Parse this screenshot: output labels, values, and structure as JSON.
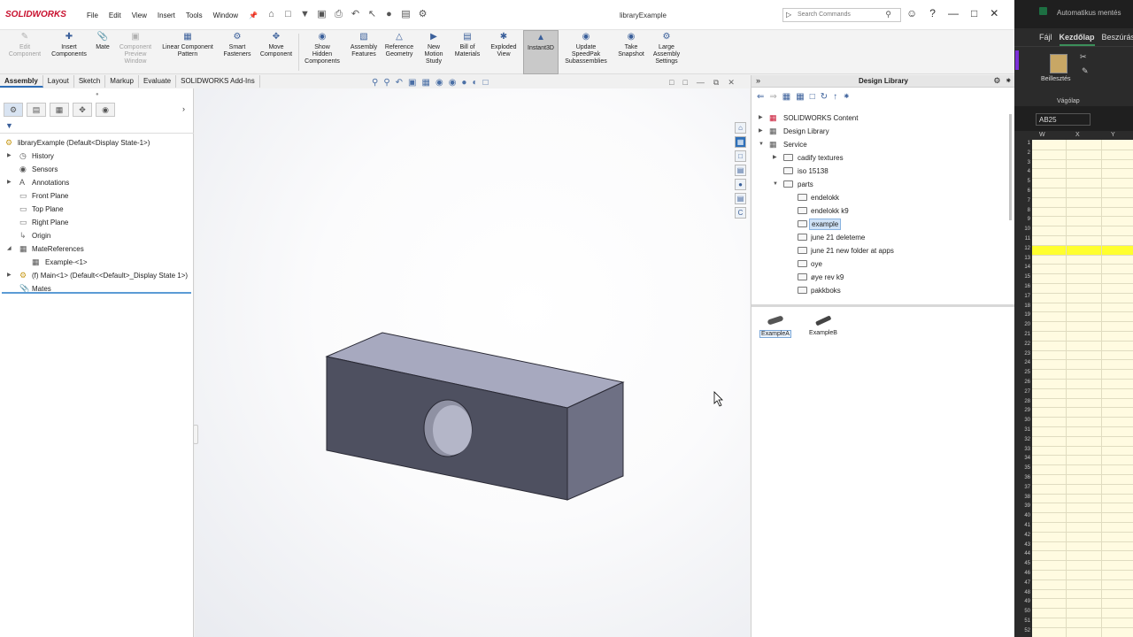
{
  "titlebar": {
    "app": "SOLIDWORKS",
    "doc_title": "libraryExample",
    "menu": [
      "File",
      "Edit",
      "View",
      "Insert",
      "Tools",
      "Window"
    ],
    "search_placeholder": "Search Commands"
  },
  "ribbon": {
    "edit_component": [
      "Edit",
      "Component"
    ],
    "insert_components": [
      "Insert",
      "Components"
    ],
    "mate": [
      "Mate"
    ],
    "component_preview": [
      "Component",
      "Preview",
      "Window"
    ],
    "linear_pattern": [
      "Linear Component",
      "Pattern"
    ],
    "smart_fasteners": [
      "Smart",
      "Fasteners"
    ],
    "move_component": [
      "Move",
      "Component"
    ],
    "show_hidden": [
      "Show",
      "Hidden",
      "Components"
    ],
    "assembly_features": [
      "Assembly",
      "Features"
    ],
    "reference_geometry": [
      "Reference",
      "Geometry"
    ],
    "new_motion_study": [
      "New",
      "Motion",
      "Study"
    ],
    "bill_of_materials": [
      "Bill of",
      "Materials"
    ],
    "exploded_view": [
      "Exploded",
      "View"
    ],
    "instant3d": [
      "Instant3D"
    ],
    "update_speedpak": [
      "Update",
      "SpeedPak",
      "Subassemblies"
    ],
    "take_snapshot": [
      "Take",
      "Snapshot"
    ],
    "large_assembly": [
      "Large",
      "Assembly",
      "Settings"
    ]
  },
  "tabs": [
    "Assembly",
    "Layout",
    "Sketch",
    "Markup",
    "Evaluate",
    "SOLIDWORKS Add-Ins"
  ],
  "feature_tree": {
    "root": "libraryExample  (Default<Display State-1>)",
    "items": [
      {
        "label": "History",
        "expandable": true,
        "indent": 1
      },
      {
        "label": "Sensors",
        "expandable": false,
        "indent": 1
      },
      {
        "label": "Annotations",
        "expandable": true,
        "indent": 1
      },
      {
        "label": "Front Plane",
        "expandable": false,
        "indent": 1
      },
      {
        "label": "Top Plane",
        "expandable": false,
        "indent": 1
      },
      {
        "label": "Right Plane",
        "expandable": false,
        "indent": 1
      },
      {
        "label": "Origin",
        "expandable": false,
        "indent": 1
      },
      {
        "label": "MateReferences",
        "expandable": true,
        "expanded": true,
        "indent": 1
      },
      {
        "label": "Example-<1>",
        "expandable": false,
        "indent": 2
      },
      {
        "label": "(f) Main<1> (Default<<Default>_Display State 1>)",
        "expandable": true,
        "indent": 1
      },
      {
        "label": "Mates",
        "expandable": false,
        "indent": 1
      }
    ]
  },
  "design_library": {
    "title": "Design Library",
    "tree": [
      {
        "label": "SOLIDWORKS Content",
        "indent": 0,
        "arrow": "collapsed"
      },
      {
        "label": "Design Library",
        "indent": 0,
        "arrow": "collapsed"
      },
      {
        "label": "Service",
        "indent": 0,
        "arrow": "expanded"
      },
      {
        "label": "cadify textures",
        "indent": 1,
        "arrow": "collapsed"
      },
      {
        "label": "iso 15138",
        "indent": 1,
        "arrow": "none"
      },
      {
        "label": "parts",
        "indent": 1,
        "arrow": "expanded"
      },
      {
        "label": "endelokk",
        "indent": 2,
        "arrow": "none"
      },
      {
        "label": "endelokk k9",
        "indent": 2,
        "arrow": "none"
      },
      {
        "label": "example",
        "indent": 2,
        "arrow": "none",
        "selected": true
      },
      {
        "label": "june 21 deleteme",
        "indent": 2,
        "arrow": "none"
      },
      {
        "label": "june 21 new folder at apps",
        "indent": 2,
        "arrow": "none"
      },
      {
        "label": "oye",
        "indent": 2,
        "arrow": "none"
      },
      {
        "label": "øye rev k9",
        "indent": 2,
        "arrow": "none"
      },
      {
        "label": "pakkboks",
        "indent": 2,
        "arrow": "none"
      }
    ],
    "parts": [
      {
        "label": "ExampleA",
        "selected": true
      },
      {
        "label": "ExampleB",
        "selected": false
      }
    ]
  },
  "excel": {
    "title_fragment": "Automatikus mentés",
    "tabs": [
      "Fájl",
      "Kezdőlap",
      "Beszúrás"
    ],
    "paste": "Beillesztés",
    "clipboard": "Vágólap",
    "cell_ref": "AB25",
    "columns": [
      "W",
      "X",
      "Y"
    ],
    "rows": [
      "1",
      "2",
      "3",
      "4",
      "5",
      "6",
      "7",
      "8",
      "9",
      "10",
      "11",
      "12",
      "13",
      "14",
      "15",
      "16",
      "17",
      "18",
      "19",
      "20",
      "21",
      "22",
      "23",
      "24",
      "25",
      "26",
      "27",
      "28",
      "29",
      "30",
      "31",
      "32",
      "33",
      "34",
      "35",
      "36",
      "37",
      "38",
      "39",
      "40",
      "41",
      "42",
      "43",
      "44",
      "45",
      "46",
      "47",
      "48",
      "49",
      "50",
      "51",
      "52"
    ],
    "highlight_row": "12",
    "highlight_color": "#ffff2e"
  },
  "colors": {
    "accent": "#2d6fb9",
    "brand": "#c8102e",
    "model_top": "#a7a9bf",
    "model_front": "#4e5060",
    "model_side": "#6e7084"
  }
}
